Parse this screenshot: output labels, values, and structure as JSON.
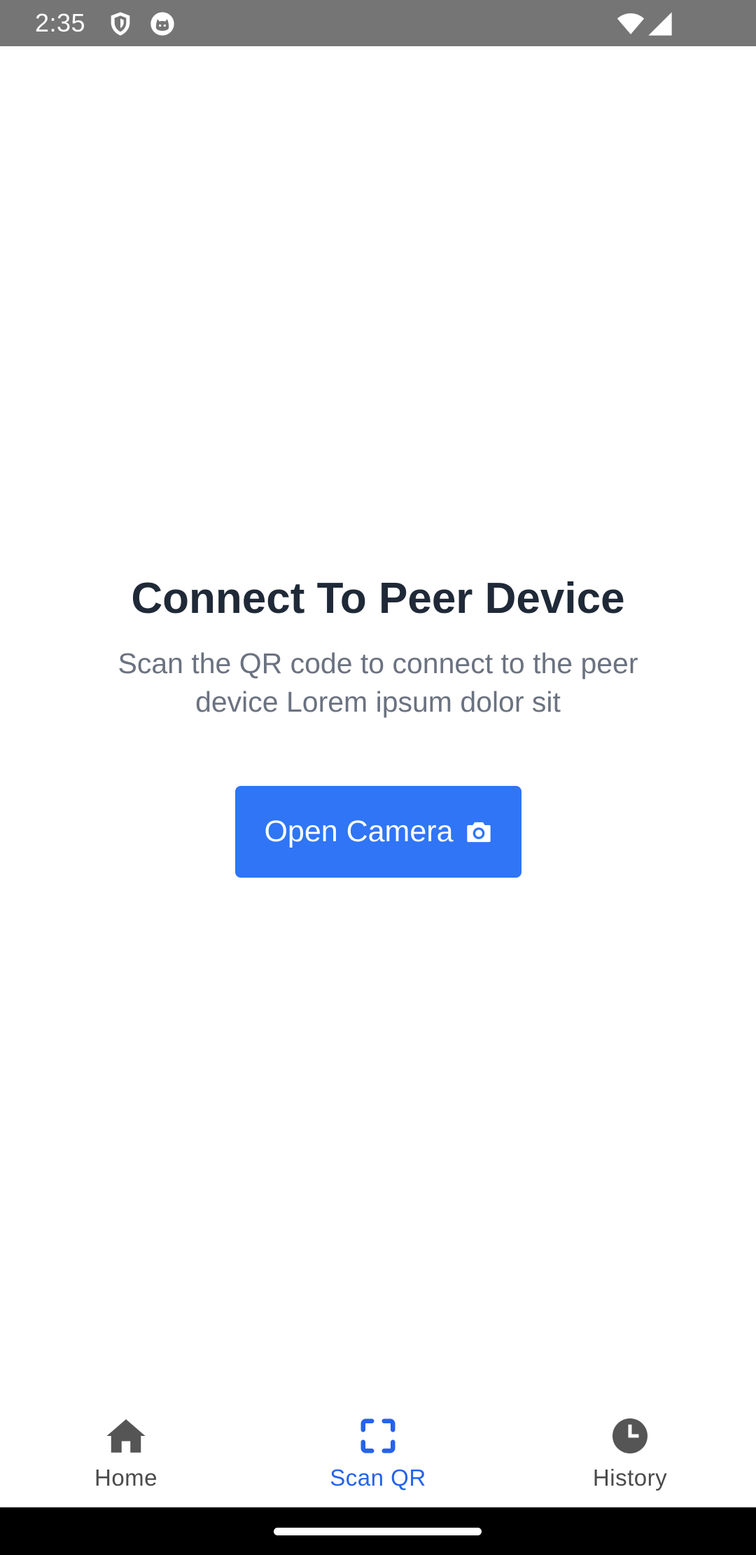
{
  "status_bar": {
    "time": "2:35",
    "icons": [
      "shield-icon",
      "cat-icon",
      "wifi-icon",
      "signal-icon"
    ]
  },
  "main": {
    "title": "Connect To Peer Device",
    "subtitle": "Scan the QR code to connect to the peer device Lorem ipsum dolor sit",
    "open_camera_label": "Open Camera",
    "open_camera_icon": "camera-icon"
  },
  "bottom_nav": {
    "items": [
      {
        "label": "Home",
        "icon": "home-icon",
        "active": false
      },
      {
        "label": "Scan QR",
        "icon": "scan-qr-icon",
        "active": true
      },
      {
        "label": "History",
        "icon": "clock-icon",
        "active": false
      }
    ]
  },
  "colors": {
    "accent": "#2f75f6",
    "active_nav": "#2563eb",
    "title": "#1f2937",
    "subtitle": "#6b7280",
    "inactive_nav": "#4b4b4b",
    "status_bar": "#757575"
  }
}
